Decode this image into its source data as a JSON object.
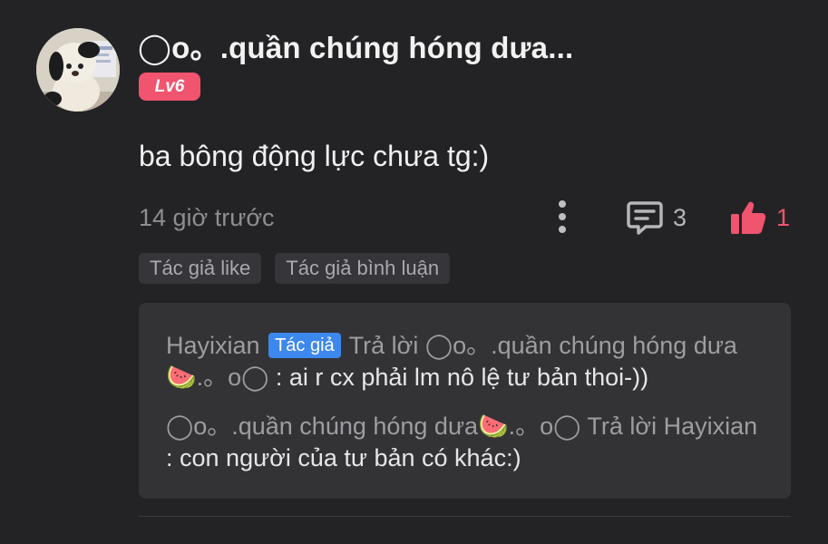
{
  "comment": {
    "username": "◯o。.quần chúng hóng dưa...",
    "level": "Lv6",
    "text": "ba bông động lực chưa tg:)",
    "timestamp": "14 giờ trước",
    "reply_count": "3",
    "like_count": "1",
    "tags": [
      "Tác giả like",
      "Tác giả bình luận"
    ]
  },
  "replies": [
    {
      "author": "Hayixian",
      "author_badge": "Tác giả",
      "action": "Trả lời",
      "target": "◯o。.quần chúng hóng dưa🍉.。o◯",
      "separator": " : ",
      "body": "ai r cx phải lm nô lệ tư bản thoi-))"
    },
    {
      "author": "◯o。.quần chúng hóng dưa🍉.。o◯",
      "action": "Trả lời",
      "target": "Hayixian",
      "separator": " : ",
      "body": "con người của tư bản có khác:)"
    }
  ],
  "icons": {
    "avatar": "plush-dog-avatar",
    "more": "vertical-dots-icon",
    "reply": "comment-bubble-icon",
    "like": "thumbs-up-icon"
  },
  "colors": {
    "background": "#232325",
    "accent_pink": "#f0546f",
    "author_blue": "#3d88ee",
    "reply_box": "#333336"
  }
}
